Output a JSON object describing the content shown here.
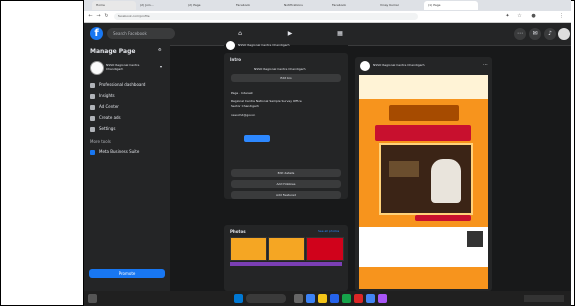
{
  "browser": {
    "tabs": [
      "Home",
      "(2) Join...",
      "(2) Page",
      "Facebook",
      "Notifications",
      "Facebook",
      "Vinay Kumar",
      "(1) Page"
    ],
    "address": "facebook.com/profile"
  },
  "facebook": {
    "search_placeholder": "Search Facebook",
    "manage_page_title": "Manage Page",
    "page_name": "NSSO Regional Centre Chandigarh",
    "menu": [
      "Professional dashboard",
      "Insights",
      "Ad Center",
      "Create ads",
      "Settings"
    ],
    "more_tools_label": "More tools",
    "meta_business_label": "Meta Business Suite",
    "promote_label": "Promote"
  },
  "middle": {
    "page_title": "NSSO Regional Centre Chandigarh",
    "intro_label": "Intro",
    "intro_text": "NSSO Regional Centre Chandigarh",
    "edit_bio": "Edit bio",
    "info_lines": [
      "Page · Interest",
      "Regional Centre National Sample Survey Office",
      "Sector Chandigarh",
      "nssochd@gov.in"
    ],
    "buttons": [
      "Edit details",
      "Add Hobbies",
      "Add Featured"
    ],
    "photos_label": "Photos",
    "see_all": "See all photos"
  },
  "post": {
    "page_name": "NSSO Regional Centre Chandigarh"
  },
  "colors": {
    "fb_blue": "#1877f2",
    "dark_bg": "#18191a",
    "card_bg": "#242526",
    "poster_orange": "#f7941d"
  }
}
